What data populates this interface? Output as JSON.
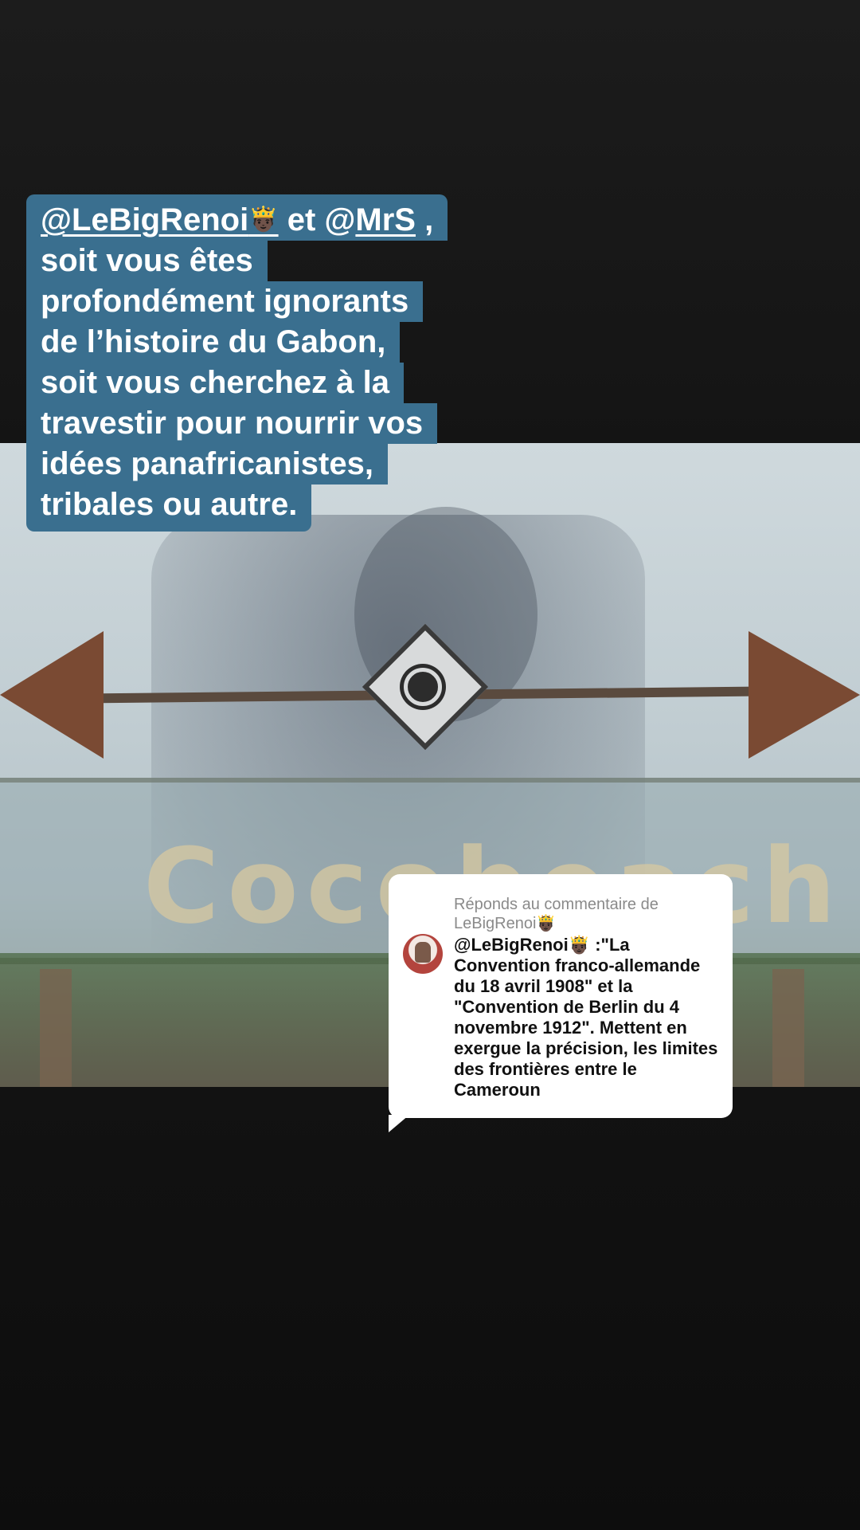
{
  "caption": {
    "mention_1": "@LeBigRenoi",
    "mention_1_emoji": "🤴🏿",
    "connector": " et ",
    "mention_2_at": "@",
    "mention_2": "MrS",
    "after_mention_2": " ,",
    "lines": [
      "soit vous êtes",
      "profondément ignorants",
      "de l’histoire du Gabon,",
      "soit vous cherchez à la",
      "travestir pour nourrir vos",
      "idées panafricanistes,",
      "tribales ou autre."
    ]
  },
  "video": {
    "sign_text": "Cocobeach"
  },
  "reply": {
    "header_prefix": "Réponds au commentaire de",
    "header_user": "LeBigRenoi",
    "header_emoji": "🤴🏿",
    "comment_user": "@LeBigRenoi",
    "comment_emoji": "🤴🏿",
    "comment_text": " :\"La Convention franco-allemande du 18 avril 1908\" et la \"Convention de Berlin du 4 novembre 1912\". Mettent en exergue la précision, les limites des frontières entre le Cameroun"
  },
  "colors": {
    "caption_bg": "#3a6f8f",
    "caption_text": "#ffffff",
    "reply_bg": "#ffffff",
    "reply_header": "#8a8a8a"
  }
}
